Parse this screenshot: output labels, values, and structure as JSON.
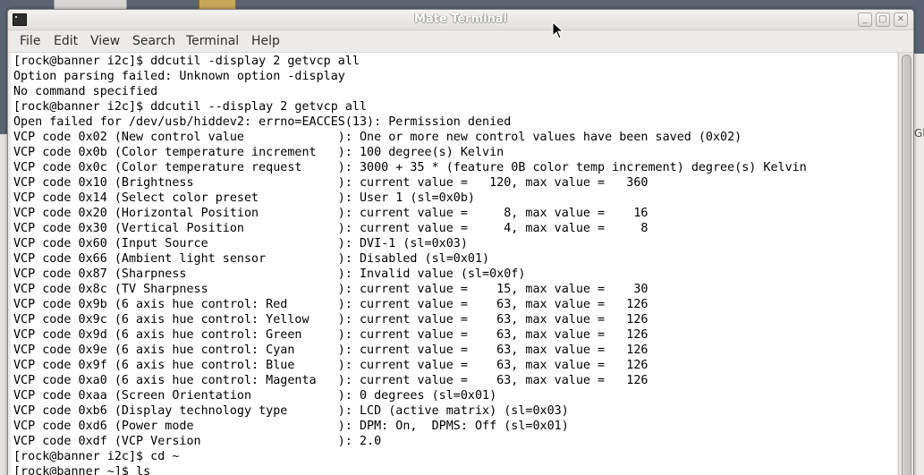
{
  "window": {
    "title": "Mate Terminal",
    "buttons": {
      "minimize": "_",
      "maximize": "□",
      "close": "✕"
    }
  },
  "menubar": {
    "items": [
      "File",
      "Edit",
      "View",
      "Search",
      "Terminal",
      "Help"
    ]
  },
  "background": {
    "right_label": "Gl"
  },
  "terminal": {
    "lines": [
      "[rock@banner i2c]$ ddcutil -display 2 getvcp all",
      "Option parsing failed: Unknown option -display",
      "No command specified",
      "[rock@banner i2c]$ ddcutil --display 2 getvcp all",
      "Open failed for /dev/usb/hiddev2: errno=EACCES(13): Permission denied",
      "VCP code 0x02 (New control value             ): One or more new control values have been saved (0x02)",
      "VCP code 0x0b (Color temperature increment   ): 100 degree(s) Kelvin",
      "VCP code 0x0c (Color temperature request     ): 3000 + 35 * (feature 0B color temp increment) degree(s) Kelvin",
      "VCP code 0x10 (Brightness                    ): current value =   120, max value =   360",
      "VCP code 0x14 (Select color preset           ): User 1 (sl=0x0b)",
      "VCP code 0x20 (Horizontal Position           ): current value =     8, max value =    16",
      "VCP code 0x30 (Vertical Position             ): current value =     4, max value =     8",
      "VCP code 0x60 (Input Source                  ): DVI-1 (sl=0x03)",
      "VCP code 0x66 (Ambient light sensor          ): Disabled (sl=0x01)",
      "VCP code 0x87 (Sharpness                     ): Invalid value (sl=0x0f)",
      "VCP code 0x8c (TV Sharpness                  ): current value =    15, max value =    30",
      "VCP code 0x9b (6 axis hue control: Red       ): current value =    63, max value =   126",
      "VCP code 0x9c (6 axis hue control: Yellow    ): current value =    63, max value =   126",
      "VCP code 0x9d (6 axis hue control: Green     ): current value =    63, max value =   126",
      "VCP code 0x9e (6 axis hue control: Cyan      ): current value =    63, max value =   126",
      "VCP code 0x9f (6 axis hue control: Blue      ): current value =    63, max value =   126",
      "VCP code 0xa0 (6 axis hue control: Magenta   ): current value =    63, max value =   126",
      "VCP code 0xaa (Screen Orientation            ): 0 degrees (sl=0x01)",
      "VCP code 0xb6 (Display technology type       ): LCD (active matrix) (sl=0x03)",
      "VCP code 0xd6 (Power mode                    ): DPM: On,  DPMS: Off (sl=0x01)",
      "VCP code 0xdf (VCP Version                   ): 2.0",
      "[rock@banner i2c]$ cd ~",
      "[rock@banner ~]$ ls"
    ]
  },
  "colors": {
    "terminal_bg": "#ffffff",
    "terminal_fg": "#000000",
    "chrome_bg": "#ecebe9"
  }
}
